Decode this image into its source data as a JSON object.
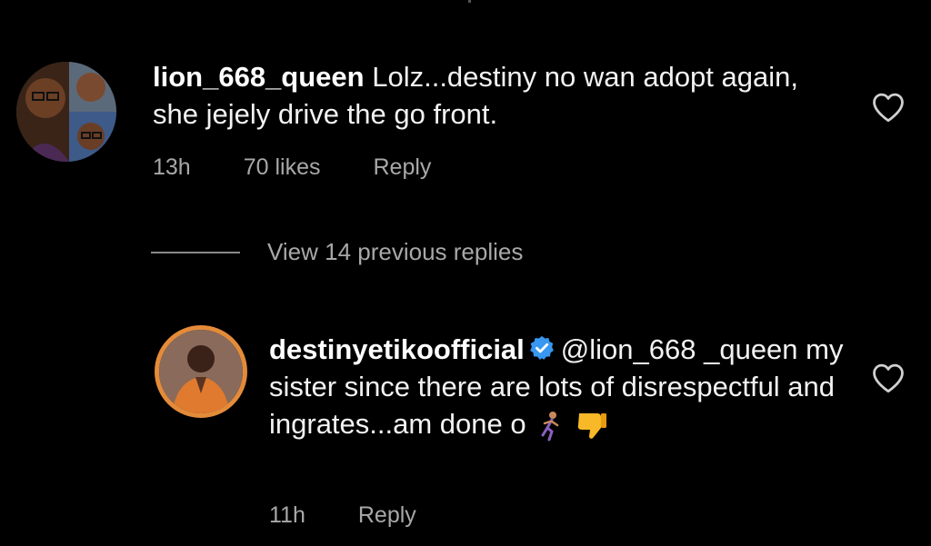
{
  "comments": [
    {
      "username": "lion_668_queen",
      "text": "Lolz...destiny no wan adopt again, she jejely drive the go front.",
      "time": "13h",
      "likes": "70 likes",
      "reply_label": "Reply",
      "liked": false
    },
    {
      "username": "destinyetikoofficial",
      "verified": true,
      "mention": "@lion_668 _queen",
      "text": "my sister since there are lots of disrespectful and ingrates...am done o",
      "emojis": [
        "running-woman-icon",
        "thumbs-down-icon"
      ],
      "time": "11h",
      "reply_label": "Reply",
      "liked": false
    }
  ],
  "replies_toggle": {
    "label": "View 14 previous replies"
  },
  "colors": {
    "background": "#000000",
    "text_primary": "#f2f2f2",
    "text_secondary": "#a8a8a8",
    "verified_badge": "#3897f0",
    "avatar_ring": "#e48b3a"
  }
}
